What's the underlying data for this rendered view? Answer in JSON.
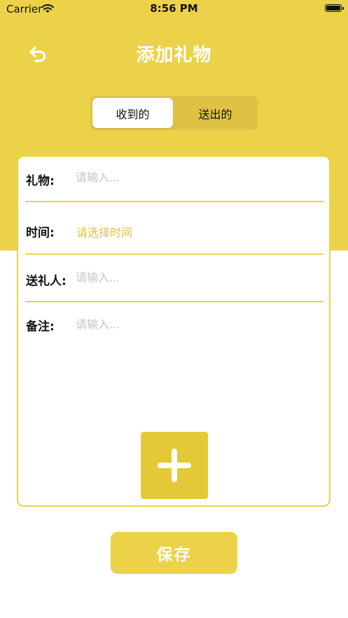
{
  "status_bar": {
    "carrier": "Carrier",
    "time": "8:56 PM",
    "wifi_icon": "wifi-icon",
    "battery_icon": "battery-icon"
  },
  "nav": {
    "title": "添加礼物",
    "back_icon": "back-arrow-icon"
  },
  "segmented": {
    "options": [
      "收到的",
      "送出的"
    ],
    "selected": "收到的"
  },
  "form": {
    "gift": {
      "label": "礼物:",
      "placeholder": "请输入..."
    },
    "time": {
      "label": "时间:",
      "value": "请选择时间"
    },
    "giver": {
      "label": "送礼人:",
      "placeholder": "请输入..."
    },
    "notes": {
      "label": "备注:",
      "placeholder": "请输入..."
    },
    "add_photo_icon": "plus-icon"
  },
  "save_button": {
    "label": "保存"
  },
  "colors": {
    "accent": "#ECD249",
    "accent_dark": "#E5C837",
    "segment_bg": "#DFC245",
    "time_text": "#E1C33F",
    "placeholder": "#C4C4C4"
  }
}
